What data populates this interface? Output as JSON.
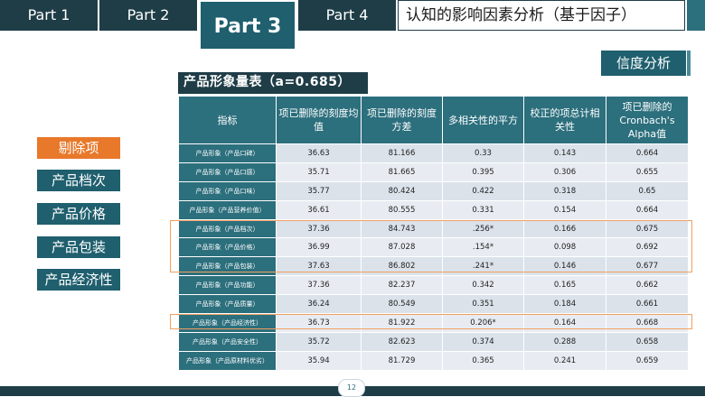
{
  "header": {
    "tabs": [
      "Part 1",
      "Part 2",
      "Part 3",
      "Part 4"
    ],
    "title": "认知的影响因素分析（基于因子）"
  },
  "section_tag": "信度分析",
  "scale_title": "产品形象量表（a=0.685）",
  "side_buttons": [
    "剔除项",
    "产品档次",
    "产品价格",
    "产品包装",
    "产品经济性"
  ],
  "table": {
    "headers": [
      "指标",
      "项已删除的刻度均值",
      "项已删除的刻度方差",
      "多相关性的平方",
      "校正的项总计相关性",
      "项已删除的Cronbach's Alpha值"
    ],
    "rows": [
      [
        "产品形象（产品口碑）",
        "36.63",
        "81.166",
        "0.33",
        "0.143",
        "0.664"
      ],
      [
        "产品形象（产品口感）",
        "35.71",
        "81.665",
        "0.395",
        "0.306",
        "0.655"
      ],
      [
        "产品形象（产品口味）",
        "35.77",
        "80.424",
        "0.422",
        "0.318",
        "0.65"
      ],
      [
        "产品形象（产品营养价值）",
        "36.61",
        "80.555",
        "0.331",
        "0.154",
        "0.664"
      ],
      [
        "产品形象（产品档次）",
        "37.36",
        "84.743",
        ".256*",
        "0.166",
        "0.675"
      ],
      [
        "产品形象（产品价格）",
        "36.99",
        "87.028",
        ".154*",
        "0.098",
        "0.692"
      ],
      [
        "产品形象（产品包装）",
        "37.63",
        "86.802",
        ".241*",
        "0.146",
        "0.677"
      ],
      [
        "产品形象（产品功能）",
        "37.36",
        "82.237",
        "0.342",
        "0.165",
        "0.662"
      ],
      [
        "产品形象（产品质量）",
        "36.24",
        "80.549",
        "0.351",
        "0.184",
        "0.661"
      ],
      [
        "产品形象（产品经济性）",
        "36.73",
        "81.922",
        "0.206*",
        "0.164",
        "0.668"
      ],
      [
        "产品形象（产品安全性）",
        "35.72",
        "82.623",
        "0.374",
        "0.288",
        "0.658"
      ],
      [
        "产品形象（产品原材料优劣）",
        "35.94",
        "81.729",
        "0.365",
        "0.241",
        "0.659"
      ]
    ]
  },
  "page_number": "12"
}
